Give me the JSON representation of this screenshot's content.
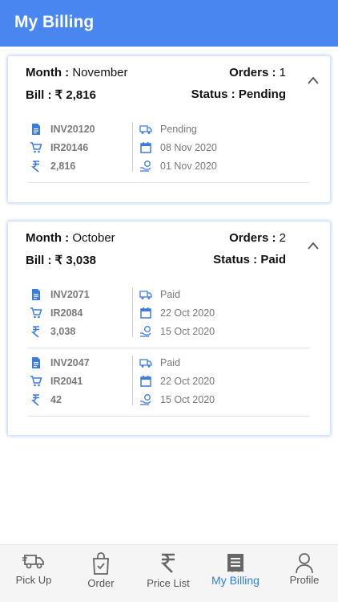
{
  "header": {
    "title": "My Billing"
  },
  "cards": [
    {
      "month_label": "Month :",
      "month_value": "November",
      "orders_label": "Orders :",
      "orders_value": "1",
      "bill_label": "Bill :",
      "bill_value": "₹ 2,816",
      "status_label": "Status :",
      "status_value": "Pending",
      "invoices": [
        {
          "invoice": "INV20120",
          "order": "IR20146",
          "amount": "2,816",
          "status": "Pending",
          "date": "08 Nov 2020",
          "paid_date": "01 Nov 2020"
        }
      ]
    },
    {
      "month_label": "Month :",
      "month_value": "October",
      "orders_label": "Orders :",
      "orders_value": "2",
      "bill_label": "Bill :",
      "bill_value": "₹ 3,038",
      "status_label": "Status :",
      "status_value": "Paid",
      "invoices": [
        {
          "invoice": "INV2071",
          "order": "IR2084",
          "amount": "3,038",
          "status": "Paid",
          "date": "22 Oct 2020",
          "paid_date": "15 Oct 2020"
        },
        {
          "invoice": "INV2047",
          "order": "IR2041",
          "amount": "42",
          "status": "Paid",
          "date": "22 Oct 2020",
          "paid_date": "15 Oct 2020"
        }
      ]
    }
  ],
  "nav": {
    "items": [
      {
        "label": "Pick Up",
        "icon": "truck-icon"
      },
      {
        "label": "Order",
        "icon": "shopping-bag-icon"
      },
      {
        "label": "Price List",
        "icon": "rupee-icon"
      },
      {
        "label": "My Billing",
        "icon": "receipt-icon",
        "active": true
      },
      {
        "label": "Profile",
        "icon": "person-icon"
      }
    ]
  },
  "colors": {
    "primary": "#4a86f0",
    "icon_blue": "#3a7bdc",
    "active_nav": "#2f7fe0"
  }
}
